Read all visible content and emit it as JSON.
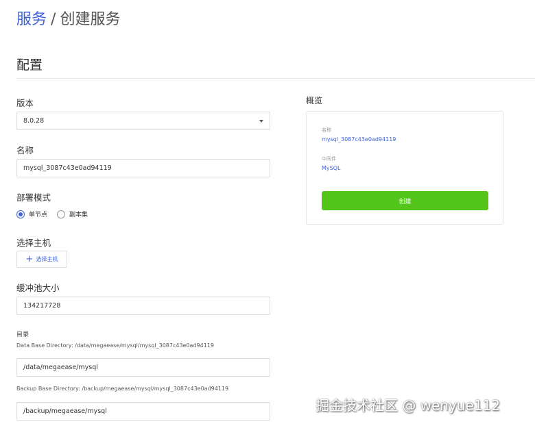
{
  "breadcrumb": {
    "root": "服务",
    "separator": "/",
    "current": "创建服务"
  },
  "section": {
    "title": "配置"
  },
  "form": {
    "version": {
      "label": "版本",
      "value": "8.0.28"
    },
    "name": {
      "label": "名称",
      "value": "mysql_3087c43e0ad94119"
    },
    "deploy_mode": {
      "label": "部署模式",
      "options": [
        "单节点",
        "副本集"
      ],
      "selected": "单节点"
    },
    "host": {
      "label": "选择主机",
      "button_label": "选择主机"
    },
    "buffer_pool": {
      "label": "缓冲池大小",
      "value": "134217728"
    },
    "directory": {
      "label": "目录",
      "data_hint": "Data Base Directory: /data/megaease/mysql/mysql_3087c43e0ad94119",
      "data_value": "/data/megaease/mysql",
      "backup_hint": "Backup Base Directory: /backup/megaease/mysql/mysql_3087c43e0ad94119",
      "backup_value": "/backup/megaease/mysql"
    }
  },
  "overview": {
    "label": "概览",
    "name_key": "名称",
    "name_value": "mysql_3087c43e0ad94119",
    "middleware_key": "中间件",
    "middleware_value": "MySQL",
    "create_button": "创建"
  },
  "watermark": "掘金技术社区 @ wenyue112",
  "colors": {
    "accent": "#3f63d9",
    "create": "#52c41a",
    "border": "#dcdcdc"
  }
}
